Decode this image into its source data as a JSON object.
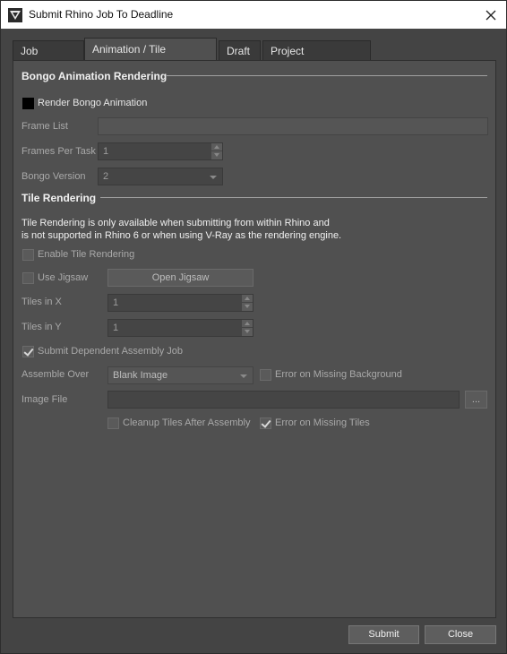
{
  "window": {
    "title": "Submit Rhino Job To Deadline"
  },
  "tabs": [
    "Job Options",
    "Animation / Tile Rendering",
    "Draft",
    "Project Management"
  ],
  "bongo": {
    "section_title": "Bongo Animation Rendering",
    "render_checkbox_label": "Render Bongo Animation",
    "frame_list_label": "Frame List",
    "frame_list_value": "",
    "frames_per_task_label": "Frames Per Task",
    "frames_per_task_value": "1",
    "version_label": "Bongo Version",
    "version_value": "2"
  },
  "tile": {
    "section_title": "Tile Rendering",
    "info_line1": "Tile Rendering is only available when submitting from within Rhino and",
    "info_line2": "is not supported in Rhino 6 or when using V-Ray as the rendering engine.",
    "enable_label": "Enable Tile Rendering",
    "use_jigsaw_label": "Use Jigsaw",
    "open_jigsaw_button": "Open Jigsaw",
    "tiles_x_label": "Tiles in X",
    "tiles_x_value": "1",
    "tiles_y_label": "Tiles in Y",
    "tiles_y_value": "1",
    "submit_assembly_label": "Submit Dependent Assembly Job",
    "assemble_over_label": "Assemble Over",
    "assemble_over_value": "Blank Image",
    "error_missing_bg_label": "Error on Missing Background",
    "image_file_label": "Image File",
    "image_file_value": "",
    "browse_button": "...",
    "cleanup_label": "Cleanup Tiles After Assembly",
    "error_missing_tiles_label": "Error on Missing Tiles"
  },
  "footer": {
    "submit_button": "Submit",
    "close_button": "Close"
  }
}
